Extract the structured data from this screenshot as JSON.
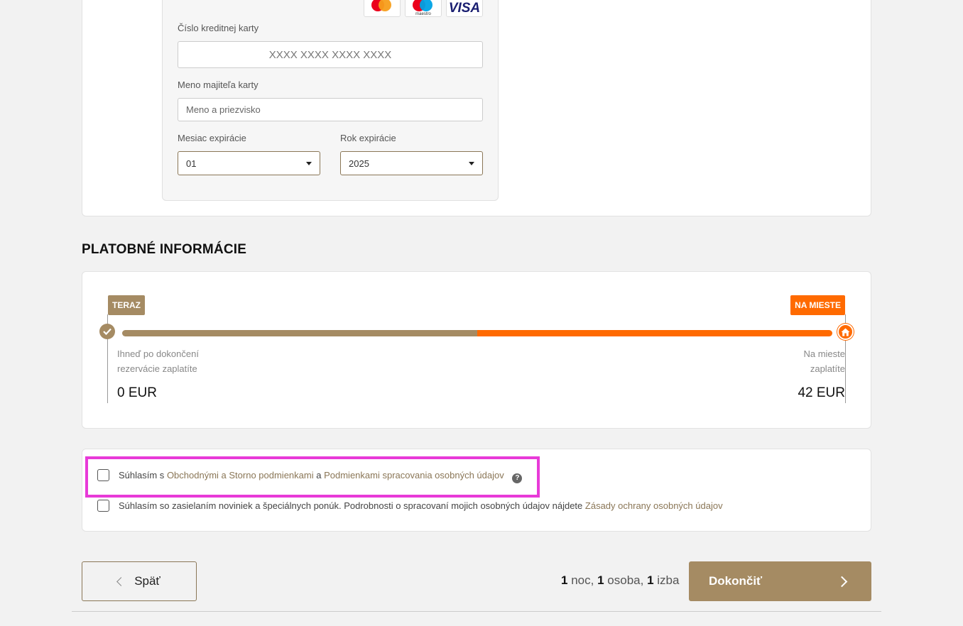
{
  "card_form": {
    "logos": [
      "mastercard-logo",
      "maestro-logo",
      "visa-logo"
    ],
    "maestro_text": "maestro",
    "visa_text": "VISA",
    "card_number_label": "Číslo kreditnej karty",
    "card_number_placeholder": "XXXX XXXX XXXX XXXX",
    "holder_label": "Meno majiteľa karty",
    "holder_placeholder": "Meno a priezvisko",
    "exp_month_label": "Mesiac expirácie",
    "exp_month_value": "01",
    "exp_year_label": "Rok expirácie",
    "exp_year_value": "2025"
  },
  "payment": {
    "title": "PLATOBNÉ INFORMÁCIE",
    "now_tag": "TERAZ",
    "later_tag": "NA MIESTE",
    "now_note_1": "Ihneď po dokončení",
    "now_note_2": "rezervácie zaplatíte",
    "later_note_1": "Na mieste",
    "later_note_2": "zaplatíte",
    "now_amount": "0 EUR",
    "later_amount": "42 EUR",
    "split_fraction": 0.5,
    "colors": {
      "now": "#a58b63",
      "later": "#ff6a00"
    }
  },
  "consent": {
    "terms_prefix": "Súhlasím s",
    "terms_link_1": "Obchodnými a Storno podmienkami",
    "terms_and": "a",
    "terms_link_2": "Podmienkami spracovania osobných údajov",
    "help_glyph": "?",
    "newsletter_text": "Súhlasím so zasielaním noviniek a špeciálnych ponúk. Podrobnosti o spracovaní mojich osobných údajov nájdete",
    "privacy_link": "Zásady ochrany osobných údajov",
    "highlight_color": "#e83ad8"
  },
  "footer": {
    "back_label": "Späť",
    "nights_count": "1",
    "nights_word": "noc,",
    "persons_count": "1",
    "persons_word": "osoba,",
    "rooms_count": "1",
    "rooms_word": "izba",
    "finish_label": "Dokončiť"
  }
}
